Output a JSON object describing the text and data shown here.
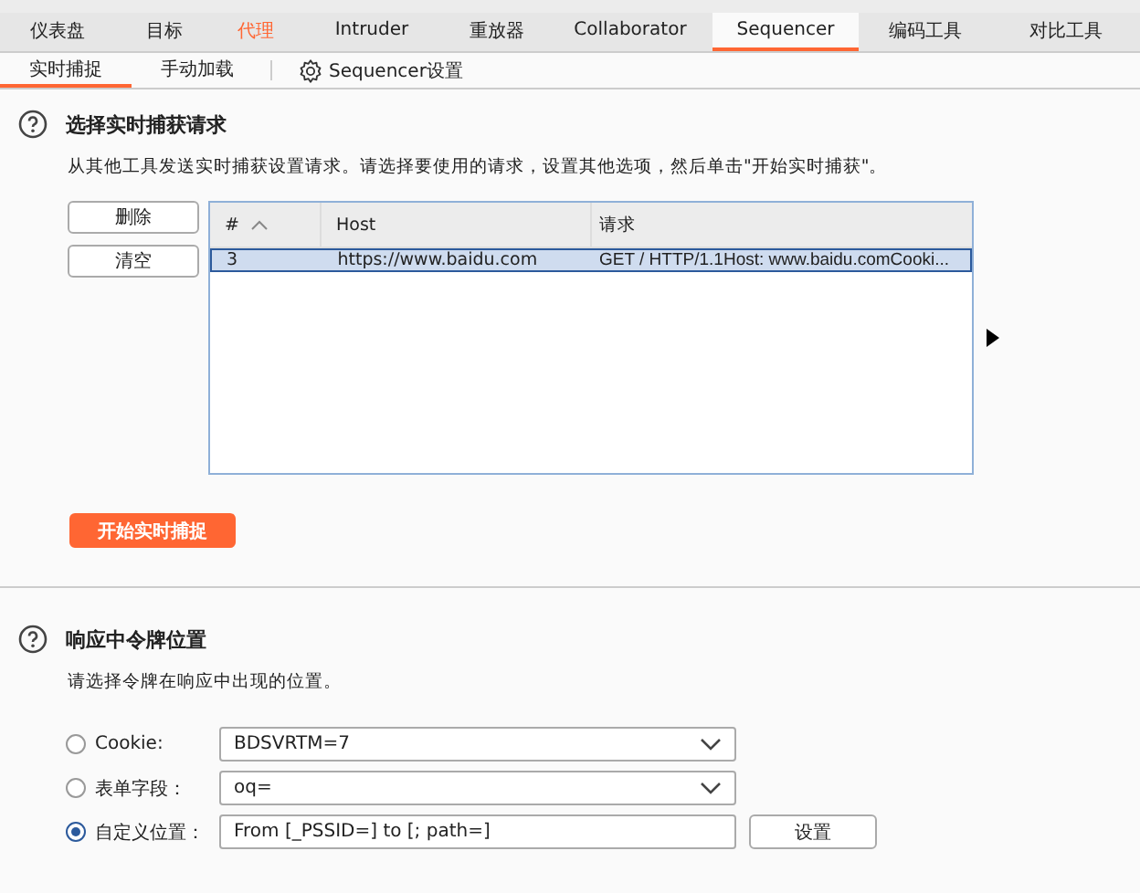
{
  "main_tabs": [
    {
      "label": "仪表盘",
      "selected": false,
      "highlighted": false
    },
    {
      "label": "目标",
      "selected": false,
      "highlighted": false
    },
    {
      "label": "代理",
      "selected": false,
      "highlighted": true
    },
    {
      "label": "Intruder",
      "selected": false,
      "highlighted": false
    },
    {
      "label": "重放器",
      "selected": false,
      "highlighted": false
    },
    {
      "label": "Collaborator",
      "selected": false,
      "highlighted": false
    },
    {
      "label": "Sequencer",
      "selected": true,
      "highlighted": false
    },
    {
      "label": "编码工具",
      "selected": false,
      "highlighted": false
    },
    {
      "label": "对比工具",
      "selected": false,
      "highlighted": false
    }
  ],
  "sub_tabs": [
    {
      "label": "实时捕捉",
      "selected": true
    },
    {
      "label": "手动加载",
      "selected": false
    }
  ],
  "settings_link": "Sequencer设置",
  "capture_section": {
    "title": "选择实时捕获请求",
    "description": "从其他工具发送实时捕获设置请求。请选择要使用的请求，设置其他选项，然后单击\"开始实时捕获\"。",
    "buttons": [
      "删除",
      "清空"
    ],
    "table": {
      "columns": [
        "#",
        "Host",
        "请求"
      ],
      "rows": [
        {
          "cells": [
            "3",
            "https://www.baidu.com",
            "GET / HTTP/1.1Host: www.baidu.comCooki..."
          ],
          "selected": true
        }
      ]
    },
    "start_button": "开始实时捕捉"
  },
  "token_section": {
    "title": "响应中令牌位置",
    "description": "请选择令牌在响应中出现的位置。",
    "options": [
      {
        "kind": "dropdown",
        "label": "Cookie:",
        "value": "BDSVRTM=7",
        "selected": false
      },
      {
        "kind": "dropdown",
        "label": "表单字段：",
        "value": "oq=",
        "selected": false
      },
      {
        "kind": "custom",
        "label": "自定义位置：",
        "value": "From [_PSSID=] to [; path=]",
        "button": "设置",
        "selected": true
      }
    ]
  }
}
